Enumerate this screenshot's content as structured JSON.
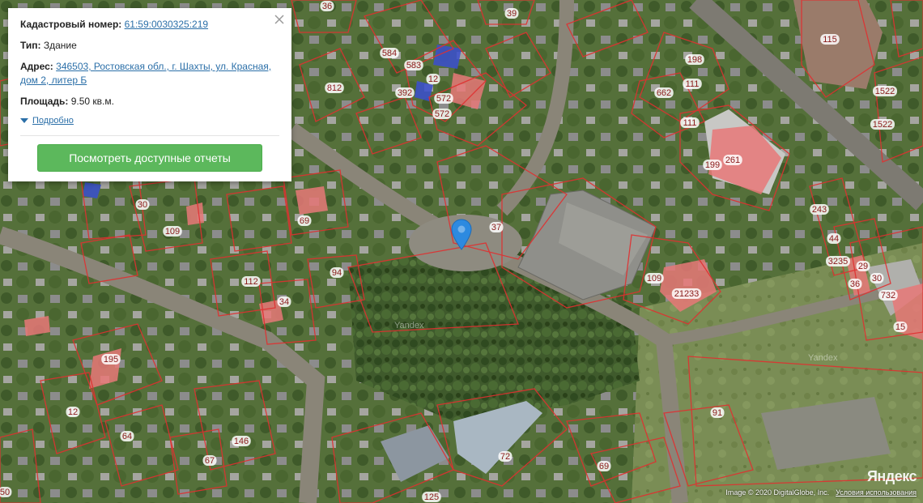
{
  "popup": {
    "cadastral_label": "Кадастровый номер:",
    "cadastral_value": "61:59:0030325:219",
    "type_label": "Тип:",
    "type_value": "Здание",
    "address_label": "Адрес:",
    "address_value": "346503, Ростовская обл., г. Шахты, ул. Красная, дом 2, литер Б",
    "area_label": "Площадь:",
    "area_value": "9.50 кв.м.",
    "more_label": "Подробно",
    "report_button": "Посмотреть доступные отчеты"
  },
  "map": {
    "plot_labels": [
      "36",
      "39",
      "115",
      "584",
      "583",
      "12",
      "572",
      "392",
      "572",
      "812",
      "198",
      "662",
      "111",
      "111",
      "1522",
      "1522",
      "261",
      "199",
      "30",
      "109",
      "69",
      "37",
      "243",
      "44",
      "3235",
      "36",
      "29",
      "30",
      "732",
      "15",
      "109",
      "21233",
      "112",
      "94",
      "34",
      "195",
      "12",
      "64",
      "146",
      "67",
      "91",
      "72",
      "69",
      "125",
      "50"
    ],
    "watermarks": [
      "Yandex",
      "Yandex"
    ]
  },
  "attribution": {
    "copyright": "Image © 2020 DigitalGlobe, Inc.",
    "terms": "Условия использования",
    "logo": "Яндекс"
  },
  "colors": {
    "boundary": "#e03030",
    "building_highlight": "#e87878",
    "button": "#5cb85c",
    "link": "#2b6fa8",
    "marker": "#2d8ae0"
  }
}
